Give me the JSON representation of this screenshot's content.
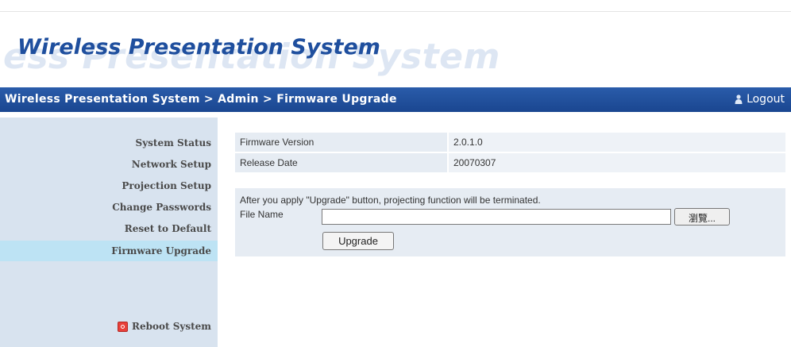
{
  "banner": {
    "title": "Wireless Presentation System",
    "watermark": "ess Presentation System"
  },
  "navbar": {
    "breadcrumb": "Wireless Presentation System > Admin > Firmware Upgrade",
    "logout_label": "Logout",
    "logout_icon": "user-icon"
  },
  "sidebar": {
    "items": [
      {
        "label": "System Status"
      },
      {
        "label": "Network Setup"
      },
      {
        "label": "Projection Setup"
      },
      {
        "label": "Change Passwords"
      },
      {
        "label": "Reset to Default"
      },
      {
        "label": "Firmware Upgrade",
        "active": true
      },
      {
        "label": "Reboot System",
        "icon": "power-icon"
      }
    ]
  },
  "firmware": {
    "version_label": "Firmware Version",
    "version_value": "2.0.1.0",
    "date_label": "Release Date",
    "date_value": "20070307",
    "note": "After you apply \"Upgrade\" button, projecting function will be terminated.",
    "file_label": "File Name",
    "file_value": "",
    "browse_label": "瀏覽...",
    "upgrade_label": "Upgrade"
  },
  "colors": {
    "navbar": "#1f4f9e",
    "sidebar": "#d8e3ef",
    "active_item": "#bde3f4",
    "title": "#1f4f9e"
  }
}
